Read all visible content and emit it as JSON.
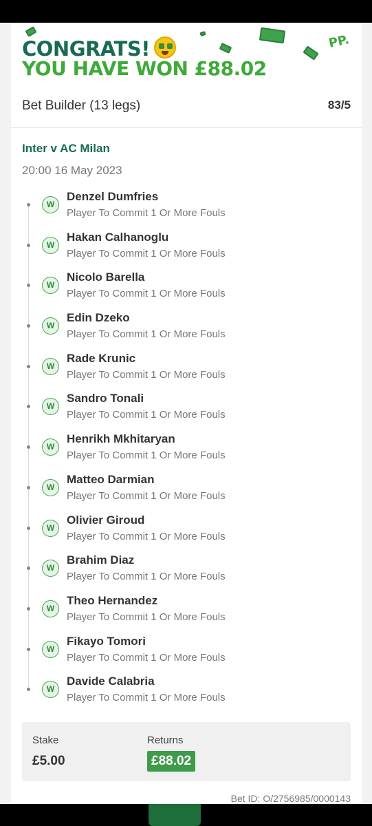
{
  "header": {
    "congrats": "CONGRATS!",
    "won": "YOU HAVE WON £88.02",
    "logo_text": "PP.",
    "emoji_icon": "money-mouth-face-icon"
  },
  "bet": {
    "title": "Bet Builder (13 legs)",
    "odds": "83/5",
    "match": "Inter v AC Milan",
    "datetime": "20:00 16 May 2023",
    "result_badge": "W",
    "legs": [
      {
        "player": "Denzel Dumfries",
        "market": "Player To Commit 1 Or More Fouls"
      },
      {
        "player": "Hakan Calhanoglu",
        "market": "Player To Commit 1 Or More Fouls"
      },
      {
        "player": "Nicolo Barella",
        "market": "Player To Commit 1 Or More Fouls"
      },
      {
        "player": "Edin Dzeko",
        "market": "Player To Commit 1 Or More Fouls"
      },
      {
        "player": "Rade Krunic",
        "market": "Player To Commit 1 Or More Fouls"
      },
      {
        "player": "Sandro Tonali",
        "market": "Player To Commit 1 Or More Fouls"
      },
      {
        "player": "Henrikh Mkhitaryan",
        "market": "Player To Commit 1 Or More Fouls"
      },
      {
        "player": "Matteo Darmian",
        "market": "Player To Commit 1 Or More Fouls"
      },
      {
        "player": "Olivier Giroud",
        "market": "Player To Commit 1 Or More Fouls"
      },
      {
        "player": "Brahim Diaz",
        "market": "Player To Commit 1 Or More Fouls"
      },
      {
        "player": "Theo Hernandez",
        "market": "Player To Commit 1 Or More Fouls"
      },
      {
        "player": "Fikayo Tomori",
        "market": "Player To Commit 1 Or More Fouls"
      },
      {
        "player": "Davide Calabria",
        "market": "Player To Commit 1 Or More Fouls"
      }
    ]
  },
  "summary": {
    "stake_label": "Stake",
    "stake": "£5.00",
    "returns_label": "Returns",
    "returns": "£88.02"
  },
  "bet_id": "Bet ID: O/2756985/0000143",
  "colors": {
    "brand_dark_green": "#176b52",
    "brand_green": "#3eaa3a",
    "win_badge": "#4aa84f",
    "returns_bg": "#3f9a4a"
  }
}
